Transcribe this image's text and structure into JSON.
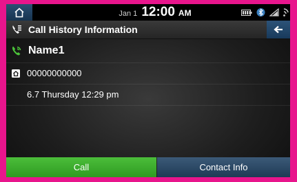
{
  "status_bar": {
    "date": "Jan 1",
    "time": "12:00",
    "ampm": "AM",
    "icons": [
      "home-icon",
      "battery-icon",
      "bluetooth-icon",
      "signal-icon",
      "wifi-icon"
    ]
  },
  "header": {
    "title": "Call History Information",
    "title_icon": "call-history-icon",
    "back_icon": "back-arrow-icon"
  },
  "contact": {
    "name": "Name1",
    "number": "00000000000",
    "datetime": "6.7 Thursday 12:29 pm"
  },
  "buttons": {
    "call": "Call",
    "contact_info": "Contact Info"
  },
  "colors": {
    "accent_green": "#3fb02f",
    "button_blue": "#2d4d6d",
    "frame": "#e8158c"
  }
}
